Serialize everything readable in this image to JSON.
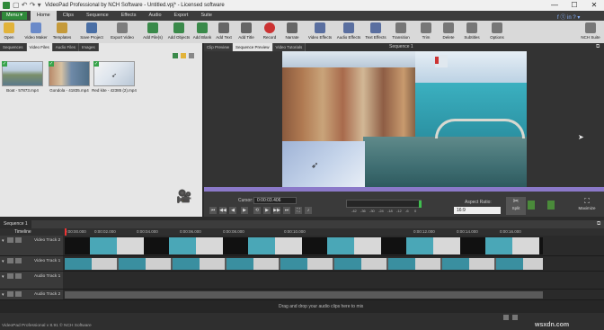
{
  "window": {
    "title": "VideoPad Professional by NCH Software - Untitled.vpj* - Licensed software"
  },
  "menu": {
    "menu_button": "Menu ▾",
    "tabs": [
      "Home",
      "Clips",
      "Sequence",
      "Effects",
      "Audio",
      "Export",
      "Suite"
    ]
  },
  "ribbon": {
    "buttons": [
      {
        "label": "Open",
        "icon": "folder-icon"
      },
      {
        "label": "Video Maker",
        "icon": "wand-icon"
      },
      {
        "label": "Templates",
        "icon": "templates-icon"
      },
      {
        "label": "Save Project",
        "icon": "save-icon"
      },
      {
        "label": "Export Video",
        "icon": "export-icon"
      },
      {
        "label": "Add File(s)",
        "icon": "add-file-icon"
      },
      {
        "label": "Add Objects",
        "icon": "add-objects-icon"
      },
      {
        "label": "Add Blank",
        "icon": "add-blank-icon"
      },
      {
        "label": "Add Text",
        "icon": "text-icon"
      },
      {
        "label": "Add Title",
        "icon": "title-icon"
      },
      {
        "label": "Record",
        "icon": "record-icon"
      },
      {
        "label": "Narrate",
        "icon": "narrate-icon"
      },
      {
        "label": "Video Effects",
        "icon": "video-effects-icon"
      },
      {
        "label": "Audio Effects",
        "icon": "audio-effects-icon"
      },
      {
        "label": "Text Effects",
        "icon": "text-effects-icon"
      },
      {
        "label": "Transition",
        "icon": "transition-icon"
      },
      {
        "label": "Trim",
        "icon": "trim-icon"
      },
      {
        "label": "Delete",
        "icon": "delete-icon"
      },
      {
        "label": "Subtitles",
        "icon": "subtitles-icon"
      },
      {
        "label": "Options",
        "icon": "options-icon"
      },
      {
        "label": "NCH Suite",
        "icon": "suite-icon"
      }
    ]
  },
  "left_pane": {
    "tabs": [
      "Sequences",
      "Video Files",
      "Audio Files",
      "Images"
    ],
    "active_tab": "Video Files",
    "files": [
      {
        "name": "Boat - 57873.mp4"
      },
      {
        "name": "Gondola - 41835.mp4"
      },
      {
        "name": "Red kite - 42385 (2).mp4"
      }
    ]
  },
  "preview": {
    "tabs": [
      "Clip Preview",
      "Sequence Preview",
      "Video Tutorials"
    ],
    "sequence_title": "Sequence 1",
    "cursor_label": "Cursor:",
    "cursor_value": "0:00:03.406",
    "aspect_label": "Aspect Ratio:",
    "aspect_value": "16:9",
    "scale_labels": [
      "-42",
      "-36",
      "-30",
      "-24",
      "-18",
      "-12",
      "-6",
      "0"
    ],
    "split_label": "Split",
    "maximize_label": "Maximize"
  },
  "timeline": {
    "sequence_tab": "Sequence 1",
    "timeline_label": "Timeline",
    "ticks": [
      "0:00:00.000",
      "0:00:02.000",
      "0:00:04.000",
      "0:00:06.000",
      "0:00:08.000",
      "0:00:10.000",
      "0:00:12.000",
      "0:00:14.000",
      "0:00:16.000"
    ],
    "tracks": [
      {
        "name": "Video Track 2"
      },
      {
        "name": "Video Track 1"
      },
      {
        "name": "Audio Track 1"
      },
      {
        "name": "Audio Track 2"
      }
    ],
    "drop_hint": "Drag and drop your audio clips here to mix"
  },
  "status": {
    "text": "VideoPad Professional v 8.91 © NCH Software"
  },
  "watermark": "wsxdn.com"
}
